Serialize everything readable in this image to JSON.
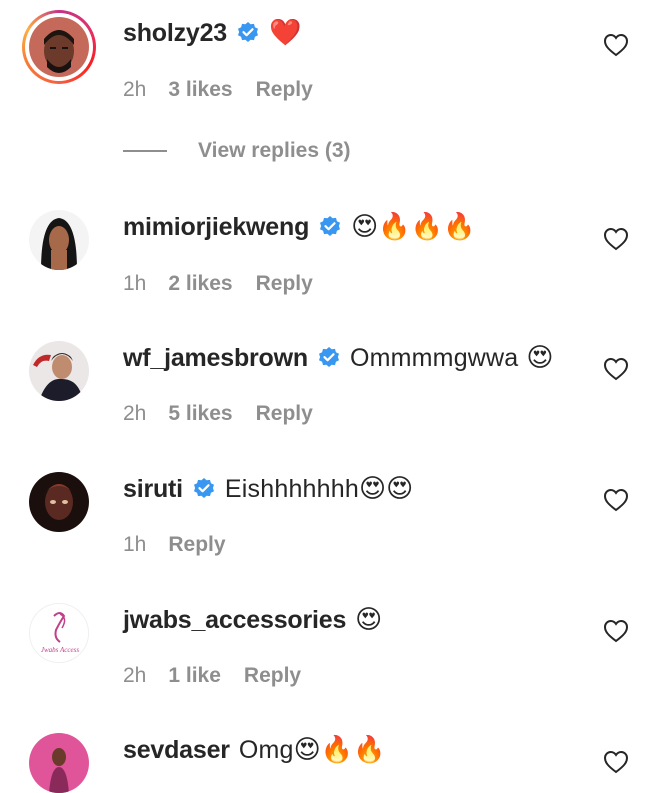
{
  "comments": [
    {
      "username": "sholzy23",
      "verified": true,
      "text": "",
      "emojis": "❤️",
      "time": "2h",
      "likes": "3 likes",
      "reply": "Reply",
      "view_replies": "View replies (3)"
    },
    {
      "username": "mimiorjiekweng",
      "verified": true,
      "text": "",
      "emojis": "😍🔥🔥🔥",
      "time": "1h",
      "likes": "2 likes",
      "reply": "Reply"
    },
    {
      "username": "wf_jamesbrown",
      "verified": true,
      "text": "Ommmmgwwa",
      "emojis": "😍",
      "time": "2h",
      "likes": "5 likes",
      "reply": "Reply"
    },
    {
      "username": "siruti",
      "verified": true,
      "text": "Eishhhhhhh",
      "emojis": "😍😍",
      "time": "1h",
      "likes": "",
      "reply": "Reply"
    },
    {
      "username": "jwabs_accessories",
      "verified": false,
      "text": "",
      "emojis": "😍",
      "time": "2h",
      "likes": "1 like",
      "reply": "Reply",
      "avatar_text": "Jwabs Access"
    },
    {
      "username": "sevdaser",
      "verified": false,
      "text": "Omg",
      "emojis": "😍🔥🔥",
      "time": "",
      "likes": "",
      "reply": ""
    }
  ],
  "icons": {
    "verified": "verified-badge-icon",
    "like": "heart-outline-icon"
  },
  "colors": {
    "verified_blue": "#3897f0",
    "meta_gray": "#8e8e8e",
    "text": "#262626"
  }
}
